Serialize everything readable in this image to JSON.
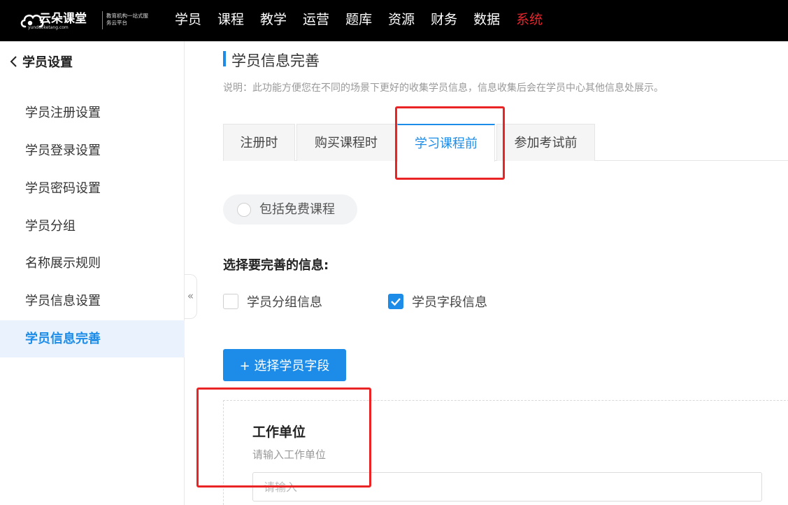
{
  "brand": {
    "name": "云朵课堂",
    "url": "yunduoketang.com",
    "slogan": "教育机构一站式服务云平台"
  },
  "nav": {
    "items": [
      {
        "label": "学员"
      },
      {
        "label": "课程"
      },
      {
        "label": "教学"
      },
      {
        "label": "运营"
      },
      {
        "label": "题库"
      },
      {
        "label": "资源"
      },
      {
        "label": "财务"
      },
      {
        "label": "数据"
      },
      {
        "label": "系统"
      }
    ],
    "active": "系统",
    "active_color": "#e5252c"
  },
  "sidebar": {
    "title": "学员设置",
    "items": [
      {
        "label": "学员注册设置"
      },
      {
        "label": "学员登录设置"
      },
      {
        "label": "学员密码设置"
      },
      {
        "label": "学员分组"
      },
      {
        "label": "名称展示规则"
      },
      {
        "label": "学员信息设置"
      },
      {
        "label": "学员信息完善"
      }
    ],
    "active": "学员信息完善",
    "collapse_icon": "«"
  },
  "main": {
    "title": "学员信息完善",
    "description": "说明：此功能方便您在不同的场景下更好的收集学员信息，信息收集后会在学员中心其他信息处展示。",
    "tabs": [
      {
        "label": "注册时"
      },
      {
        "label": "购买课程时"
      },
      {
        "label": "学习课程前"
      },
      {
        "label": "参加考试前"
      }
    ],
    "active_tab": "学习课程前",
    "free_course_radio": {
      "label": "包括免费课程",
      "checked": false
    },
    "section_label": "选择要完善的信息:",
    "options": [
      {
        "label": "学员分组信息",
        "checked": false
      },
      {
        "label": "学员字段信息",
        "checked": true
      }
    ],
    "select_button": "+ 选择学员字段",
    "field": {
      "title": "工作单位",
      "hint": "请输入工作单位",
      "placeholder": "请输入",
      "value": ""
    }
  },
  "colors": {
    "accent": "#1c8ce8",
    "annotation_red": "#ea2424",
    "topbar": "#000000"
  }
}
